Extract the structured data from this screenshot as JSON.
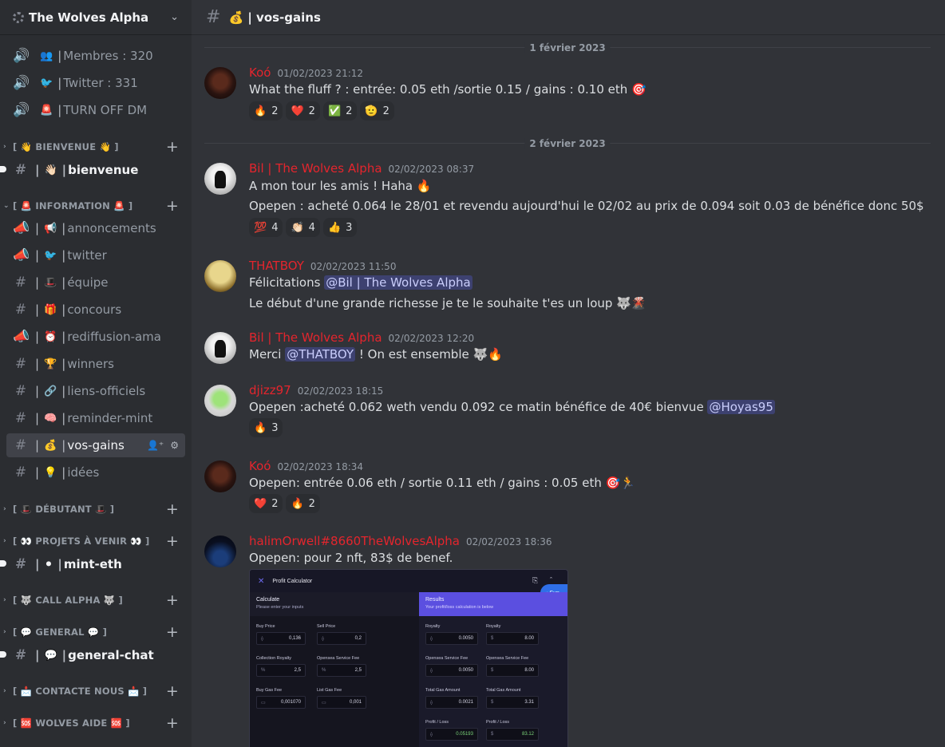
{
  "server": {
    "name": "The Wolves Alpha"
  },
  "sidebar": {
    "channels": [
      {
        "kind": "voice",
        "emoji": "👥",
        "label": "Membres : 320"
      },
      {
        "kind": "voice",
        "emoji": "🐦",
        "label": "Twitter : 331"
      },
      {
        "kind": "voice",
        "emoji": "🚨",
        "label": "TURN OFF DM"
      }
    ],
    "categories": [
      {
        "label": "[ 👋 BIENVENUE 👋 ]",
        "collapsed": true,
        "items": [
          {
            "label": "bienvenue",
            "emoji": "👋🏻",
            "unread": true
          }
        ]
      },
      {
        "label": "[ 🚨 INFORMATION 🚨 ]",
        "collapsed": false,
        "items": [
          {
            "label": "annoncements",
            "emoji": "📢",
            "icon": "megaphone-icon"
          },
          {
            "label": "twitter",
            "emoji": "🐦",
            "icon": "megaphone-icon"
          },
          {
            "label": "équipe",
            "emoji": "🎩",
            "icon": "hash-icon"
          },
          {
            "label": "concours",
            "emoji": "🎁",
            "icon": "hash-icon"
          },
          {
            "label": "rediffusion-ama",
            "emoji": "⏰",
            "icon": "megaphone-icon"
          },
          {
            "label": "winners",
            "emoji": "🏆",
            "icon": "hash-icon"
          },
          {
            "label": "liens-officiels",
            "emoji": "🔗",
            "icon": "hash-icon"
          },
          {
            "label": "reminder-mint",
            "emoji": "🧠",
            "icon": "hash-icon"
          },
          {
            "label": "vos-gains",
            "emoji": "💰",
            "icon": "hash-icon",
            "selected": true
          },
          {
            "label": "idées",
            "emoji": "💡",
            "icon": "hash-icon"
          }
        ]
      },
      {
        "label": "[ 🎩 DÉBUTANT 🎩 ]",
        "collapsed": true,
        "items": []
      },
      {
        "label": "[ 👀 PROJETS À VENIR 👀 ]",
        "collapsed": true,
        "items": [
          {
            "label": "mint-eth",
            "emoji": "⚫",
            "unread": true
          }
        ]
      },
      {
        "label": "[ 🐺 CALL ALPHA 🐺 ]",
        "collapsed": true,
        "items": []
      },
      {
        "label": "[ 💬 GENERAL 💬 ]",
        "collapsed": true,
        "items": [
          {
            "label": "general-chat",
            "emoji": "💬",
            "unread": true
          }
        ]
      },
      {
        "label": "[ 📩 CONTACTE NOUS 📩 ]",
        "collapsed": true,
        "items": []
      },
      {
        "label": "[ 🆘 WOLVES AIDE 🆘 ]",
        "collapsed": true,
        "items": []
      }
    ]
  },
  "channel": {
    "title": "💰 | vos-gains"
  },
  "dividers": [
    "1 février 2023",
    "2 février 2023"
  ],
  "messages": [
    {
      "user": "Koó",
      "time": "01/02/2023 21:12",
      "lines": [
        "What the fluff ? : entrée: 0.05 eth /sortie 0.15 / gains : 0.10 eth 🎯"
      ],
      "reactions": [
        {
          "emoji": "🔥",
          "count": "2"
        },
        {
          "emoji": "❤️",
          "count": "2"
        },
        {
          "emoji": "✅",
          "count": "2"
        },
        {
          "emoji": "🫡",
          "count": "2"
        }
      ]
    },
    {
      "user": "Bil | The Wolves Alpha",
      "time": "02/02/2023 08:37",
      "lines": [
        "A mon tour les amis ! Haha 🔥",
        "Opepen : acheté 0.064 le 28/01 et revendu aujourd'hui le 02/02 au prix de 0.094 soit 0.03 de bénéfice donc 50$"
      ],
      "reactions": [
        {
          "emoji": "💯",
          "count": "4"
        },
        {
          "emoji": "👏🏻",
          "count": "4"
        },
        {
          "emoji": "👍",
          "count": "3"
        }
      ]
    },
    {
      "user": "THATBOY",
      "time": "02/02/2023 11:50",
      "line1_prefix": "Félicitations ",
      "line1_mention": "@Bil | The Wolves Alpha",
      "lines": [
        "Le début d'une grande richesse je te le souhaite t'es un loup 🐺🌋"
      ]
    },
    {
      "user": "Bil | The Wolves Alpha",
      "time": "02/02/2023 12:20",
      "prefix": "Merci ",
      "mention": "@THATBOY",
      "suffix": " ! On est ensemble 🐺🔥"
    },
    {
      "user": "djizz97",
      "time": "02/02/2023 18:15",
      "prefix": "Opepen :acheté 0.062 weth vendu 0.092 ce matin bénéfice de 40€ bienvue ",
      "mention": "@Hoyas95",
      "reactions": [
        {
          "emoji": "🔥",
          "count": "3"
        }
      ]
    },
    {
      "user": "Koó",
      "time": "02/02/2023 18:34",
      "lines": [
        "Opepen: entrée 0.06 eth / sortie 0.11 eth / gains : 0.05 eth 🎯🏃"
      ],
      "reactions": [
        {
          "emoji": "❤️",
          "count": "2"
        },
        {
          "emoji": "🔥",
          "count": "2"
        }
      ]
    },
    {
      "user": "halimOrwell#8660TheWolvesAlpha",
      "time": "02/02/2023 18:36",
      "lines": [
        "Opepen: pour 2 nft, 83$ de benef."
      ]
    }
  ],
  "calculator": {
    "title": "Profit Calculator",
    "sun_label": "Sun",
    "left_title": "Calculate",
    "left_sub": "Please enter your inputs",
    "right_title": "Results",
    "right_sub": "Your profit/loss calculation is below",
    "fields": [
      {
        "label": "Buy Price",
        "value": "0,136",
        "prefix": "⟠"
      },
      {
        "label": "Sell Price",
        "value": "0,2",
        "prefix": "⟠"
      },
      {
        "label": "Collection Royalty",
        "value": "2,5",
        "prefix": "%"
      },
      {
        "label": "Opensea Service Fee",
        "value": "2,5",
        "prefix": "%"
      },
      {
        "label": "Buy Gas Fee",
        "value": "0,001070",
        "prefix": "▭"
      },
      {
        "label": "List Gas Fee",
        "value": "0,001",
        "prefix": "▭"
      }
    ],
    "results": [
      {
        "label": "Royalty",
        "value": "0.0050",
        "prefix": "⟠"
      },
      {
        "label": "Royalty",
        "value": "8.00",
        "prefix": "$"
      },
      {
        "label": "Opensea Service Fee",
        "value": "0.0050",
        "prefix": "⟠"
      },
      {
        "label": "Opensea Service Fee",
        "value": "8.00",
        "prefix": "$"
      },
      {
        "label": "Total Gas Amount",
        "value": "0.0021",
        "prefix": "⟠"
      },
      {
        "label": "Total Gas Amount",
        "value": "3.31",
        "prefix": "$"
      },
      {
        "label": "Profit / Loss",
        "value": "0.05193",
        "prefix": "⟠",
        "positive": true
      },
      {
        "label": "Profit / Loss",
        "value": "83.12",
        "prefix": "$",
        "positive": true
      }
    ]
  },
  "colors": {
    "accent_username": "#e4252d",
    "mention_bg": "#3c4270",
    "sidebar_bg": "#2b2d31",
    "chat_bg": "#313338"
  }
}
